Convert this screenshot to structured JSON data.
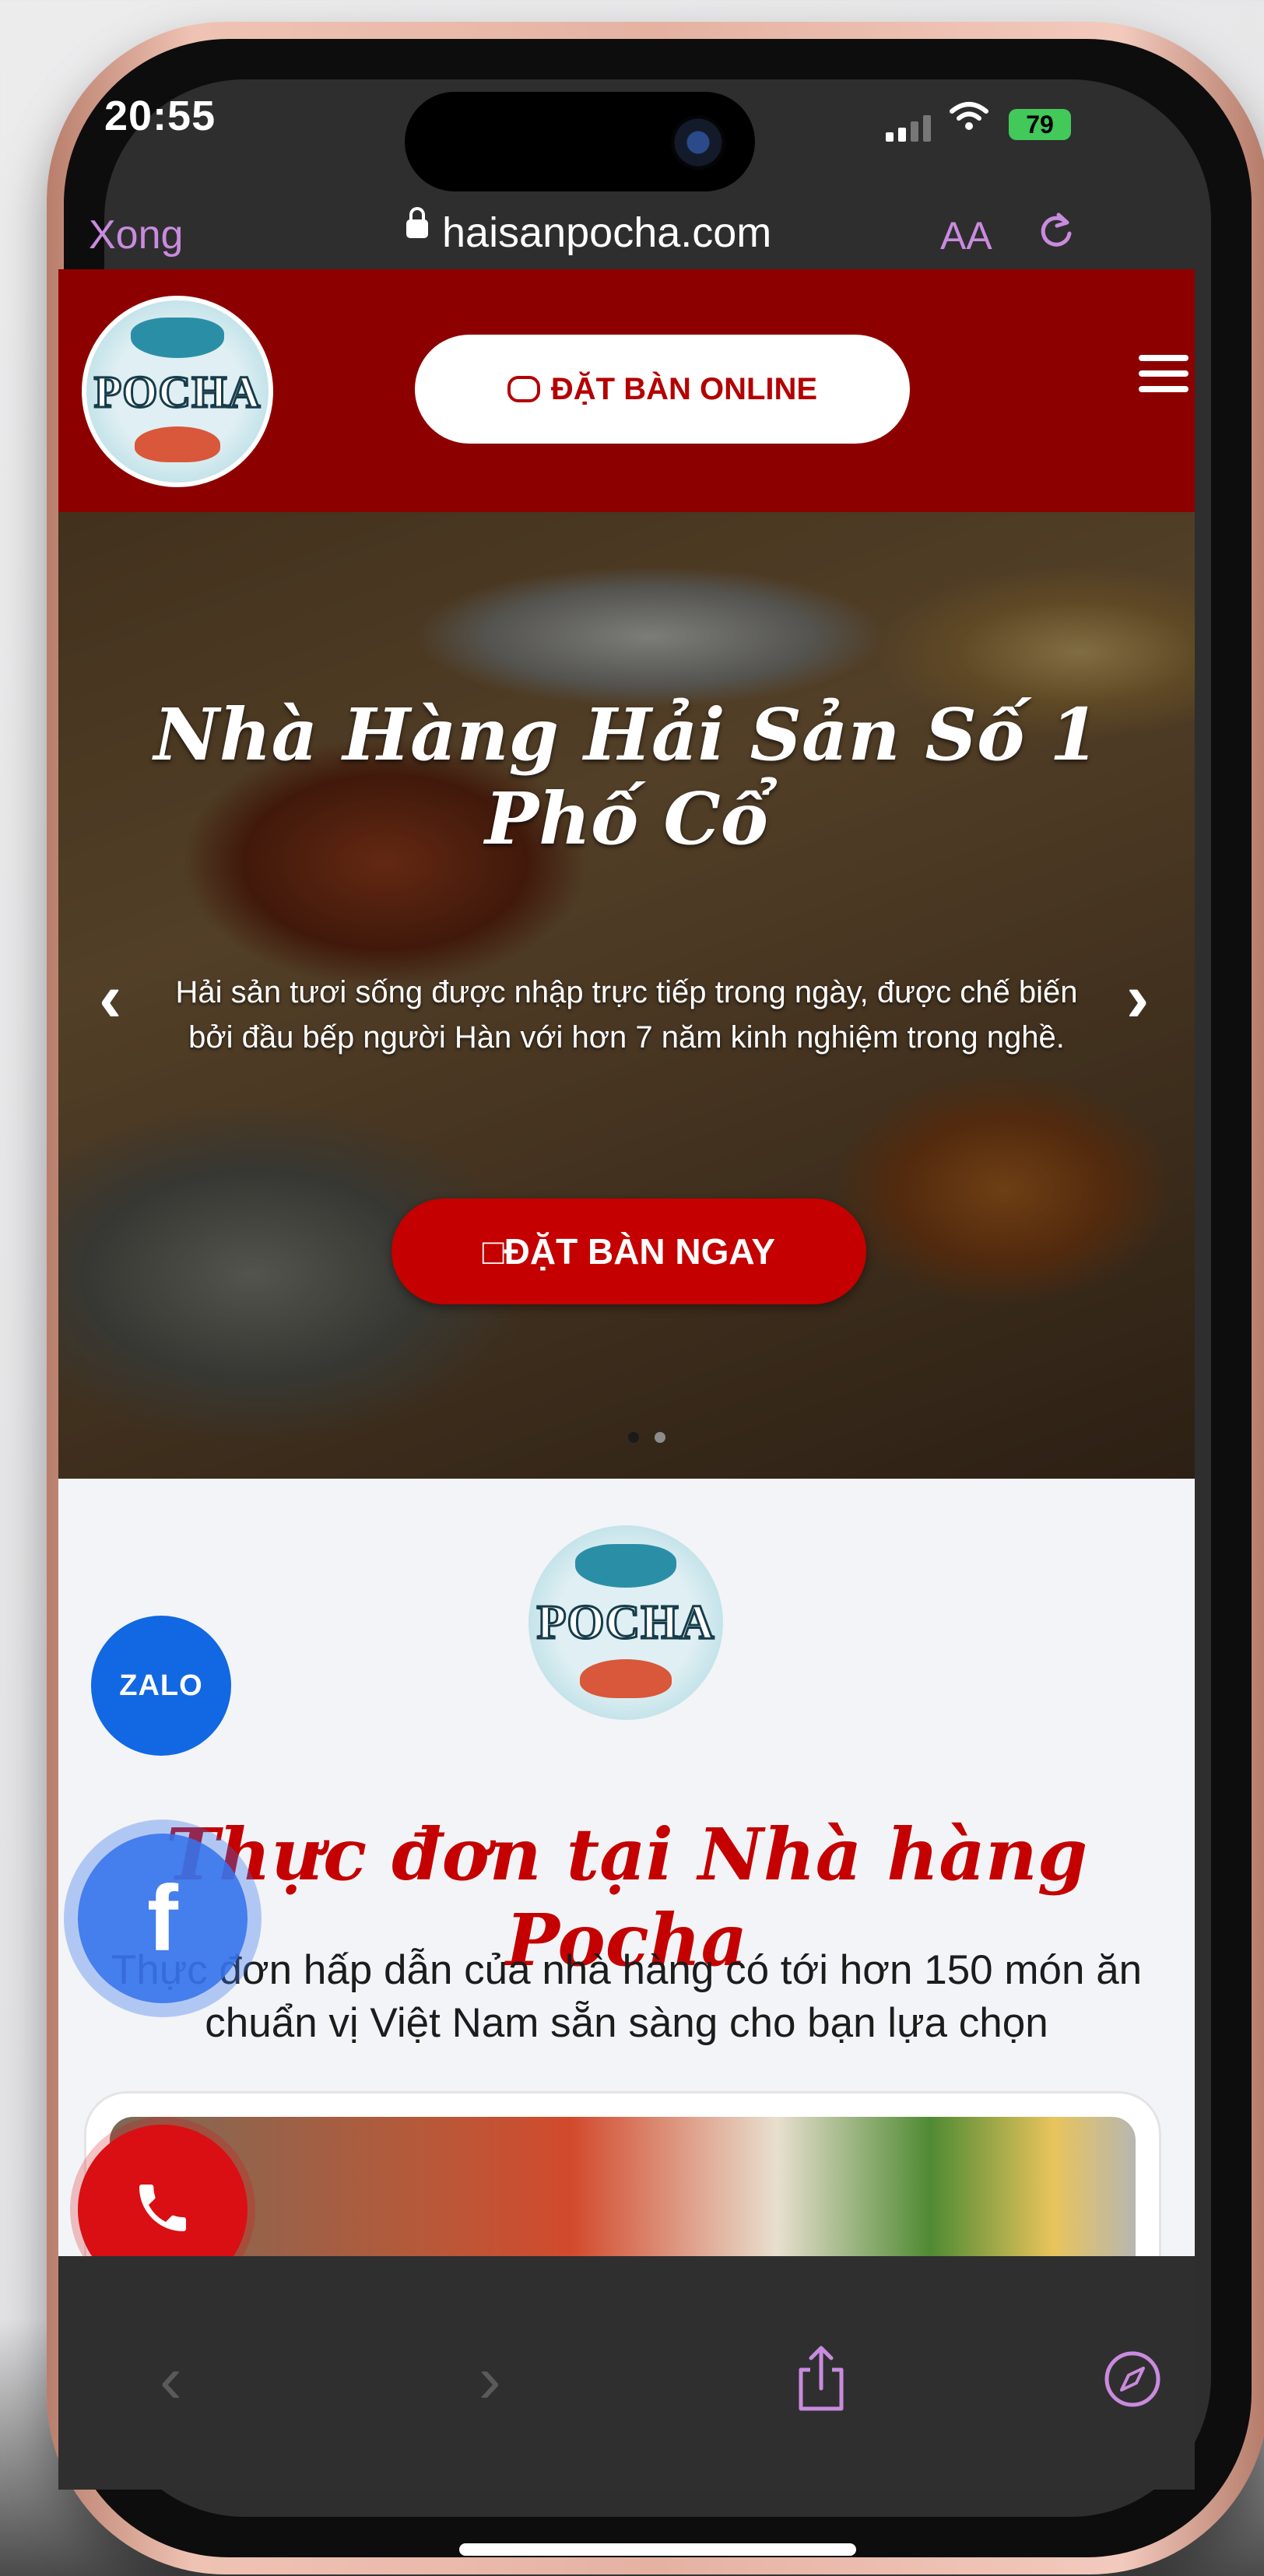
{
  "status_bar": {
    "time": "20:55",
    "battery": "79"
  },
  "browser": {
    "done_label": "Xong",
    "url": "haisanpocha.com",
    "text_size_label": "AA"
  },
  "site_header": {
    "logo_text": "POCHA",
    "book_online_label": "ĐẶT BÀN ONLINE"
  },
  "hero": {
    "title": "Nhà Hàng Hải Sản Số 1 Phố Cổ",
    "description": "Hải sản tươi sống được nhập trực tiếp trong ngày, được chế biến bởi đầu bếp người Hàn với hơn 7 năm kinh nghiệm trong nghề.",
    "cta_label": "□ĐẶT BÀN NGAY",
    "prev_arrow": "‹",
    "next_arrow": "›",
    "slide_index": 1,
    "slide_count": 2
  },
  "menu_section": {
    "logo_text": "POCHA",
    "title": "Thực đơn tại Nhà hàng Pocha",
    "description": "Thực đơn hấp dẫn của nhà hàng có tới hơn 150 món ăn chuẩn vị Việt Nam sẵn sàng cho bạn lựa chọn"
  },
  "floating": {
    "zalo_label": "ZALO",
    "facebook_label": "f"
  },
  "colors": {
    "header_red": "#8d0000",
    "cta_red": "#c40000",
    "title_red": "#c40000",
    "zalo_blue": "#1168e2",
    "facebook_blue": "#3673eb",
    "call_red": "#d90f14",
    "safari_purple": "#c98bde"
  },
  "icons": [
    "lock-icon",
    "reload-icon",
    "chat-icon",
    "menu-icon",
    "phone-icon",
    "share-icon",
    "compass-icon"
  ]
}
